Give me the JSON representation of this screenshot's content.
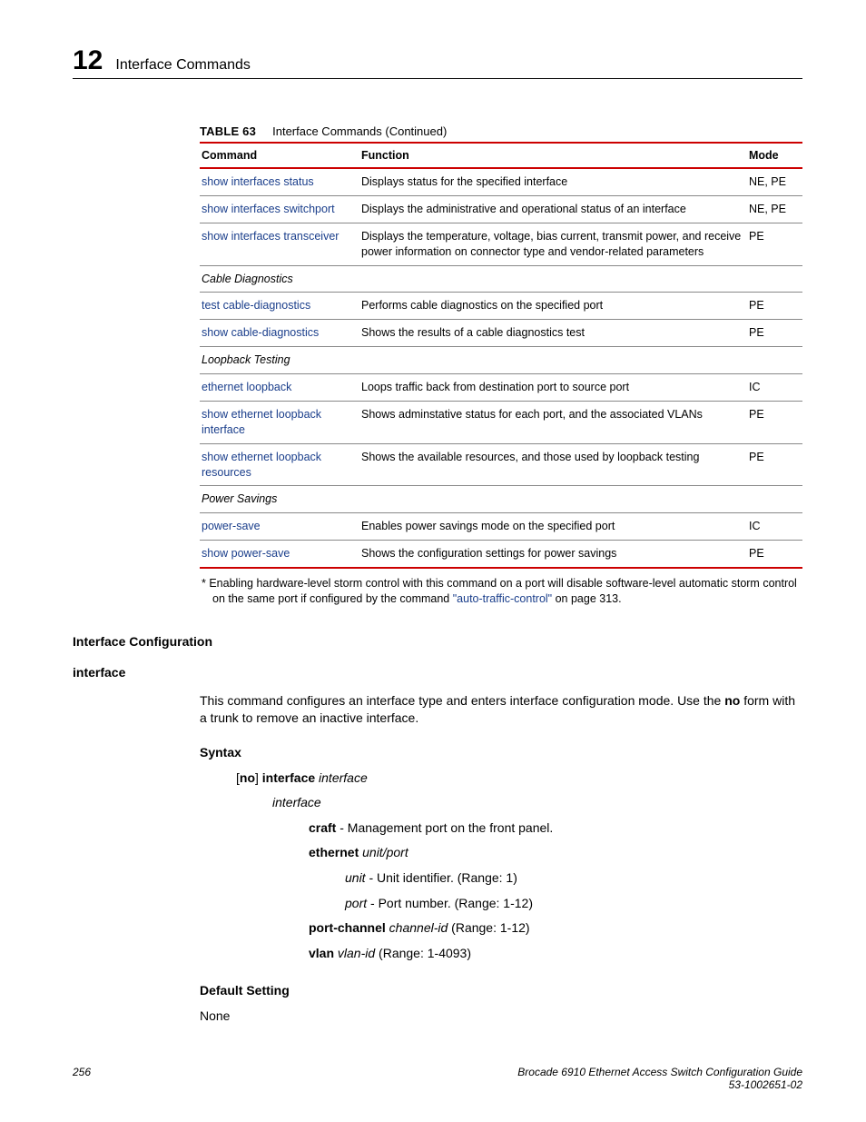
{
  "header": {
    "chapter_number": "12",
    "chapter_title": "Interface Commands"
  },
  "table": {
    "number": "TABLE 63",
    "caption": "Interface Commands (Continued)",
    "columns": {
      "command": "Command",
      "function": "Function",
      "mode": "Mode"
    },
    "rows": [
      {
        "command": "show interfaces status",
        "function": "Displays status for the specified interface",
        "mode": "NE, PE"
      },
      {
        "command": "show interfaces switchport",
        "function": "Displays the administrative and operational status of an interface",
        "mode": "NE, PE"
      },
      {
        "command": "show interfaces transceiver",
        "function": "Displays the temperature, voltage, bias current, transmit power, and receive power information on connector type and vendor-related parameters",
        "mode": "PE"
      },
      {
        "group": "Cable Diagnostics"
      },
      {
        "command": "test cable-diagnostics",
        "function": "Performs cable diagnostics on the specified port",
        "mode": "PE"
      },
      {
        "command": "show cable-diagnostics",
        "function": "Shows the results of a cable diagnostics test",
        "mode": "PE"
      },
      {
        "group": "Loopback Testing"
      },
      {
        "command": "ethernet loopback",
        "function": "Loops traffic back from destination port to source port",
        "mode": "IC"
      },
      {
        "command": "show ethernet loopback interface",
        "function": "Shows adminstative status for each port, and the associated VLANs",
        "mode": "PE"
      },
      {
        "command": "show ethernet loopback resources",
        "function": "Shows the available resources, and those used by loopback testing",
        "mode": "PE"
      },
      {
        "group": "Power Savings"
      },
      {
        "command": "power-save",
        "function": "Enables power savings mode on the specified port",
        "mode": "IC"
      },
      {
        "command": "show power-save",
        "function": "Shows the configuration settings for power savings",
        "mode": "PE"
      }
    ],
    "footnote_prefix": "*  Enabling hardware-level storm control with this command on a port will disable software-level automatic storm control on the same port if configured by the command ",
    "footnote_link": "\"auto-traffic-control\"",
    "footnote_suffix": " on page 313."
  },
  "sections": {
    "h1": "Interface Configuration",
    "h2": "interface",
    "desc_pre": "This command configures an interface type and enters interface configuration mode. Use the ",
    "desc_no": "no",
    "desc_post": " form with a trunk to remove an inactive interface.",
    "syntax_h": "Syntax",
    "syntax_line_open": "[",
    "syntax_line_no": "no",
    "syntax_line_close": "] ",
    "syntax_line_cmd": "interface",
    "syntax_line_arg": " interface",
    "interface_it": "interface",
    "craft_b": "craft",
    "craft_desc": " - Management port on the front panel.",
    "eth_b": "ethernet",
    "eth_arg": " unit/port",
    "unit_it": "unit",
    "unit_desc": " - Unit identifier. (Range: 1)",
    "port_it": "port",
    "port_desc": " - Port number. (Range: 1-12)",
    "pc_b": "port-channel",
    "pc_arg": " channel-id",
    "pc_range": " (Range: 1-12)",
    "vlan_b": "vlan",
    "vlan_arg": " vlan-id",
    "vlan_range": " (Range: 1-4093)",
    "default_h": "Default Setting",
    "default_val": "None"
  },
  "footer": {
    "page": "256",
    "doc_title": "Brocade 6910 Ethernet Access Switch Configuration Guide",
    "doc_num": "53-1002651-02"
  }
}
